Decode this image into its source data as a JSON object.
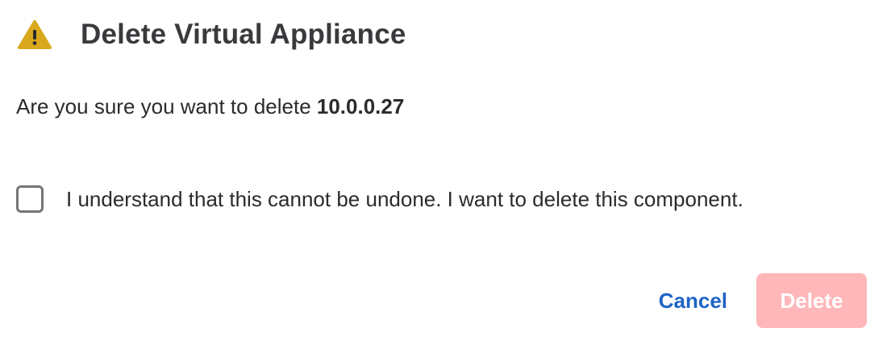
{
  "dialog": {
    "icon": "warning-triangle-icon",
    "title": "Delete Virtual Appliance",
    "message_prefix": "Are you sure you want to delete ",
    "message_target": "10.0.0.27",
    "confirm_label": "I understand that this cannot be undone. I want to delete this component.",
    "confirm_checked": false,
    "cancel_label": "Cancel",
    "delete_label": "Delete",
    "delete_enabled": false
  },
  "colors": {
    "warning": "#D9A81C",
    "link": "#1F63C6",
    "delete_disabled_bg": "#FFB7BA",
    "text": "#2B2B2F"
  }
}
